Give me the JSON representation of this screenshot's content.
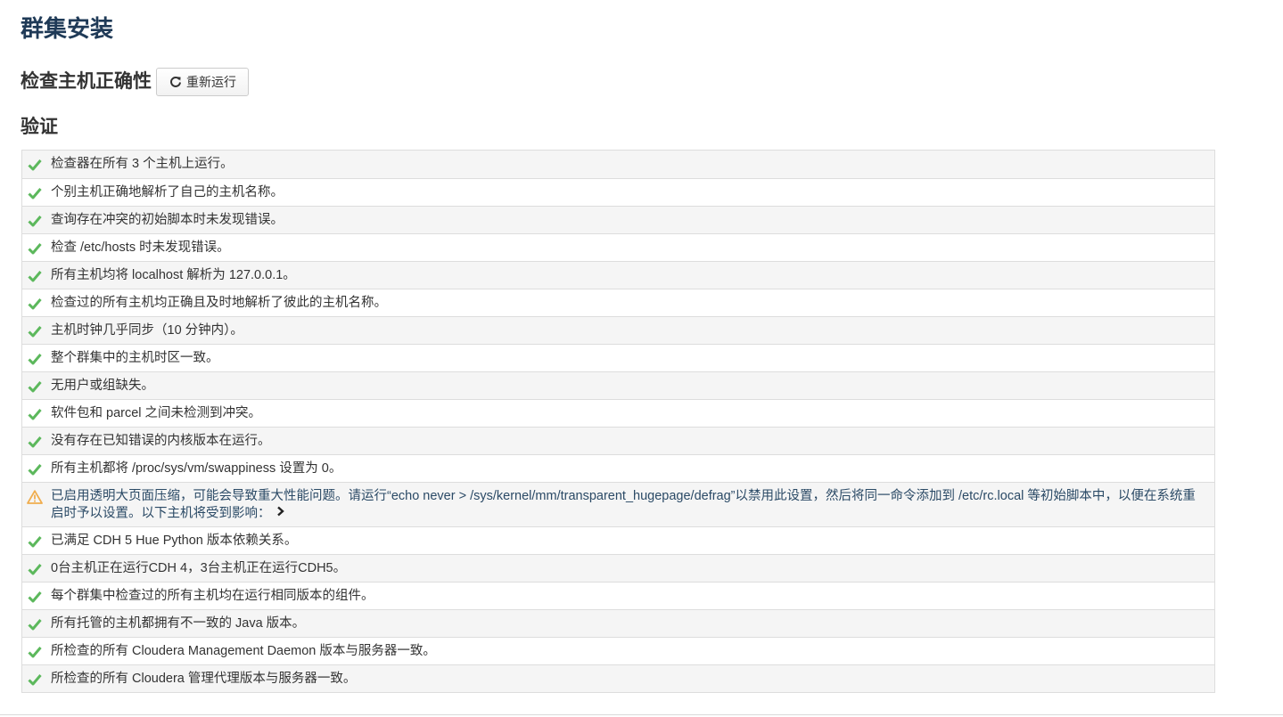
{
  "page": {
    "title": "群集安装"
  },
  "section": {
    "title": "检查主机正确性",
    "rerun_label": "重新运行"
  },
  "verification": {
    "title": "验证",
    "checks": [
      {
        "status": "ok",
        "text": "检查器在所有 3 个主机上运行。"
      },
      {
        "status": "ok",
        "text": "个别主机正确地解析了自己的主机名称。"
      },
      {
        "status": "ok",
        "text": "查询存在冲突的初始脚本时未发现错误。"
      },
      {
        "status": "ok",
        "text": "检查 /etc/hosts 时未发现错误。"
      },
      {
        "status": "ok",
        "text": "所有主机均将 localhost 解析为 127.0.0.1。"
      },
      {
        "status": "ok",
        "text": "检查过的所有主机均正确且及时地解析了彼此的主机名称。"
      },
      {
        "status": "ok",
        "text": "主机时钟几乎同步（10 分钟内）。"
      },
      {
        "status": "ok",
        "text": "整个群集中的主机时区一致。"
      },
      {
        "status": "ok",
        "text": "无用户或组缺失。"
      },
      {
        "status": "ok",
        "text": "软件包和 parcel 之间未检测到冲突。"
      },
      {
        "status": "ok",
        "text": "没有存在已知错误的内核版本在运行。"
      },
      {
        "status": "ok",
        "text": "所有主机都将 /proc/sys/vm/swappiness 设置为 0。"
      },
      {
        "status": "warning",
        "text": "已启用透明大页面压缩，可能会导致重大性能问题。请运行“echo never > /sys/kernel/mm/transparent_hugepage/defrag”以禁用此设置，然后将同一命令添加到 /etc/rc.local 等初始脚本中，以便在系统重启时予以设置。以下主机将受到影响："
      },
      {
        "status": "ok",
        "text": "已满足 CDH 5 Hue Python 版本依赖关系。"
      },
      {
        "status": "ok",
        "text": "0台主机正在运行CDH 4，3台主机正在运行CDH5。"
      },
      {
        "status": "ok",
        "text": "每个群集中检查过的所有主机均在运行相同版本的组件。"
      },
      {
        "status": "ok",
        "text": "所有托管的主机都拥有不一致的 Java 版本。"
      },
      {
        "status": "ok",
        "text": "所检查的所有 Cloudera Management Daemon 版本与服务器一致。"
      },
      {
        "status": "ok",
        "text": "所检查的所有 Cloudera 管理代理版本与服务器一致。"
      }
    ]
  },
  "icons": {
    "ok": "check-icon",
    "warning": "warning-icon",
    "refresh": "refresh-icon",
    "expand": "chevron-right-icon"
  },
  "colors": {
    "ok": "#5cb85c",
    "warning": "#f0ad4e",
    "title": "#1f3a57"
  }
}
